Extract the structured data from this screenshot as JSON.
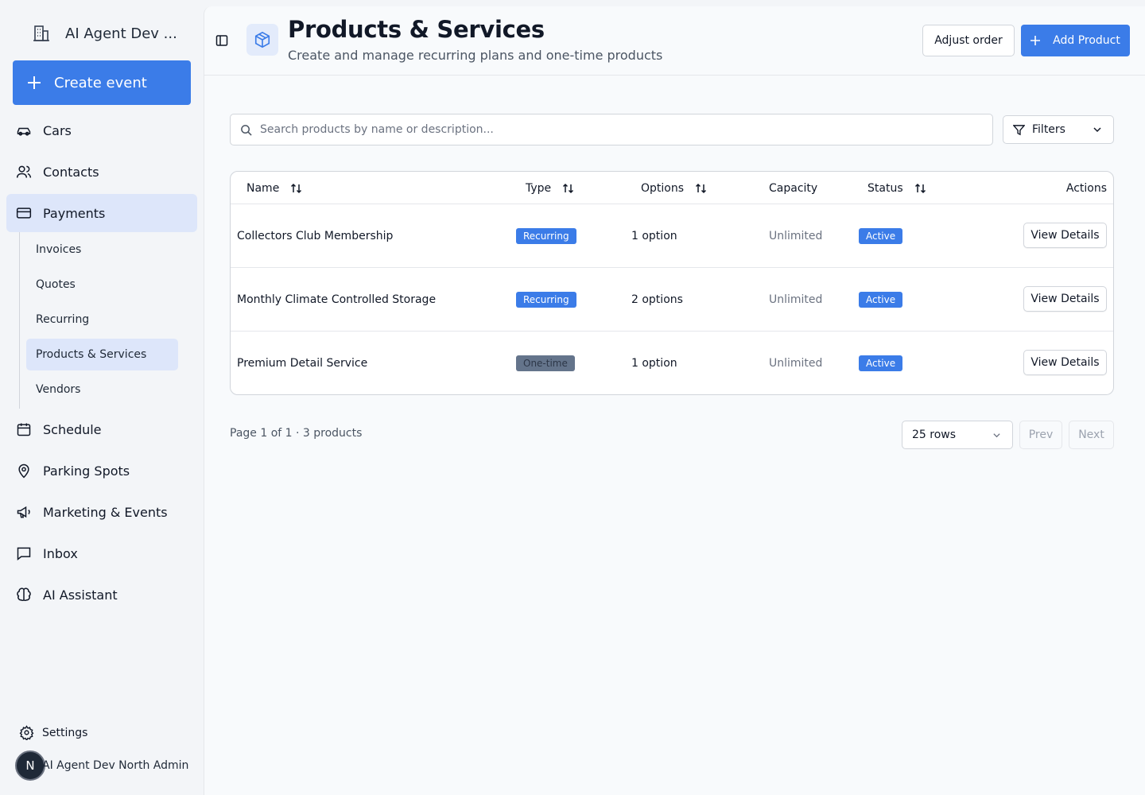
{
  "sidebar": {
    "brand": "AI Agent Dev ...",
    "create_label": "Create event",
    "nav": {
      "cars": "Cars",
      "contacts": "Contacts",
      "payments": "Payments",
      "schedule": "Schedule",
      "parking": "Parking Spots",
      "marketing": "Marketing & Events",
      "inbox": "Inbox",
      "ai": "AI Assistant"
    },
    "sub": {
      "invoices": "Invoices",
      "quotes": "Quotes",
      "recurring": "Recurring",
      "products": "Products & Services",
      "vendors": "Vendors"
    },
    "settings": "Settings",
    "user_initial": "N",
    "user_name": "AI Agent Dev North Admin"
  },
  "header": {
    "title": "Products & Services",
    "subtitle": "Create and manage recurring plans and one-time products",
    "adjust_label": "Adjust order",
    "add_label": "Add Product"
  },
  "search": {
    "placeholder": "Search products by name or description...",
    "value": ""
  },
  "filters_label": "Filters",
  "table": {
    "columns": {
      "name": "Name",
      "type": "Type",
      "options": "Options",
      "capacity": "Capacity",
      "status": "Status",
      "actions": "Actions"
    },
    "rows": [
      {
        "name": "Collectors Club Membership",
        "type": "Recurring",
        "options": "1 option",
        "capacity": "Unlimited",
        "status": "Active",
        "action": "View Details"
      },
      {
        "name": "Monthly Climate Controlled Storage",
        "type": "Recurring",
        "options": "2 options",
        "capacity": "Unlimited",
        "status": "Active",
        "action": "View Details"
      },
      {
        "name": "Premium Detail Service",
        "type": "One-time",
        "options": "1 option",
        "capacity": "Unlimited",
        "status": "Active",
        "action": "View Details"
      }
    ]
  },
  "pagination": {
    "info": "Page 1 of 1 · 3 products",
    "rows_label": "25 rows",
    "prev": "Prev",
    "next": "Next"
  },
  "colors": {
    "accent": "#3b7ce8",
    "active_nav": "#dde6fa",
    "onetime_badge": "#64748b"
  }
}
